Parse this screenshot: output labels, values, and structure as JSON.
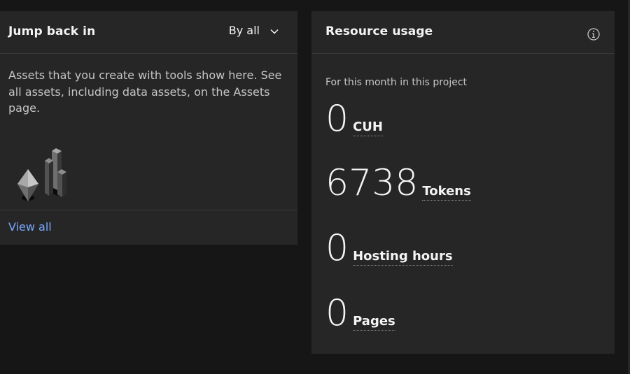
{
  "jump_back": {
    "title": "Jump back in",
    "filter_label": "By all",
    "description": "Assets that you create with tools show here. See all assets, including data assets, on the Assets page.",
    "view_all": "View all"
  },
  "resource_usage": {
    "title": "Resource usage",
    "caption": "For this month in this project",
    "metrics": [
      {
        "value": "0",
        "unit": "CUH"
      },
      {
        "value": "6738",
        "unit": "Tokens"
      },
      {
        "value": "0",
        "unit": "Hosting hours"
      },
      {
        "value": "0",
        "unit": "Pages"
      }
    ]
  },
  "icons": {
    "filter_chevron": "chevron-down-icon",
    "info": "information-icon",
    "illustration": "assets-illustration"
  },
  "colors": {
    "background": "#161616",
    "tile": "#262626",
    "link": "#78a9ff",
    "text": "#f4f4f4"
  }
}
